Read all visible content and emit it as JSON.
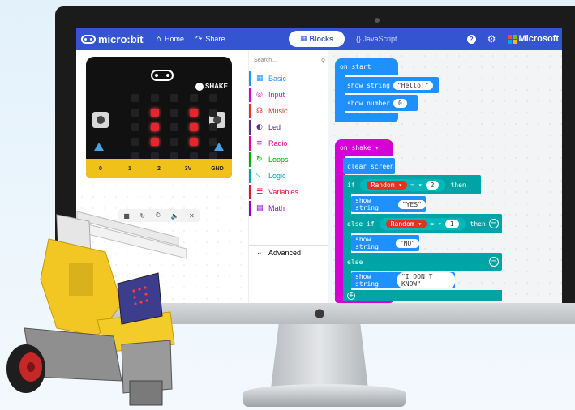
{
  "topbar": {
    "brand": "micro:bit",
    "home": "Home",
    "share": "Share",
    "mode_blocks": "Blocks",
    "mode_js": "{} JavaScript",
    "help": "?",
    "vendor": "Microsoft",
    "icons": [
      "home-icon",
      "share-icon",
      "blocks-icon",
      "help-icon",
      "gear-icon",
      "microsoft-logo"
    ]
  },
  "simulator": {
    "shake_label": "SHAKE",
    "pins": [
      "0",
      "1",
      "2",
      "3V",
      "GND"
    ],
    "led_matrix": [
      [
        0,
        0,
        0,
        0,
        0
      ],
      [
        0,
        1,
        0,
        1,
        0
      ],
      [
        0,
        1,
        0,
        1,
        0
      ],
      [
        0,
        1,
        0,
        1,
        0
      ],
      [
        0,
        0,
        0,
        0,
        0
      ]
    ],
    "controls": [
      "stop-icon",
      "restart-icon",
      "slowmo-icon",
      "mute-icon",
      "fullscreen-icon"
    ]
  },
  "toolbox": {
    "search_placeholder": "Search...",
    "categories": [
      {
        "label": "Basic",
        "color": "#1e90ff"
      },
      {
        "label": "Input",
        "color": "#d400d4"
      },
      {
        "label": "Music",
        "color": "#e63022"
      },
      {
        "label": "Led",
        "color": "#5c2d91"
      },
      {
        "label": "Radio",
        "color": "#e3008c"
      },
      {
        "label": "Loops",
        "color": "#00aa00"
      },
      {
        "label": "Logic",
        "color": "#00a4a6"
      },
      {
        "label": "Variables",
        "color": "#dc143c"
      },
      {
        "label": "Math",
        "color": "#9400d3"
      }
    ],
    "advanced": "Advanced"
  },
  "workspace": {
    "on_start": "on start",
    "show_string_1": "show string",
    "hello": "\"Hello!\"",
    "show_number": "show number",
    "number_val": "0",
    "on_shake": "on  shake ▾",
    "clear_screen": "clear screen",
    "if_label": "if",
    "random": "Random ▾",
    "eq": "= ▾",
    "val_2": "2",
    "then": "then",
    "show_string_2": "show string",
    "yes": "\"YES\"",
    "else_if": "else if",
    "val_1": "1",
    "then2": "then",
    "show_string_3": "show string",
    "no": "\"NO\"",
    "else_label": "else",
    "show_string_4": "show string",
    "dont_know": "\"I DON'T KNOW\""
  }
}
